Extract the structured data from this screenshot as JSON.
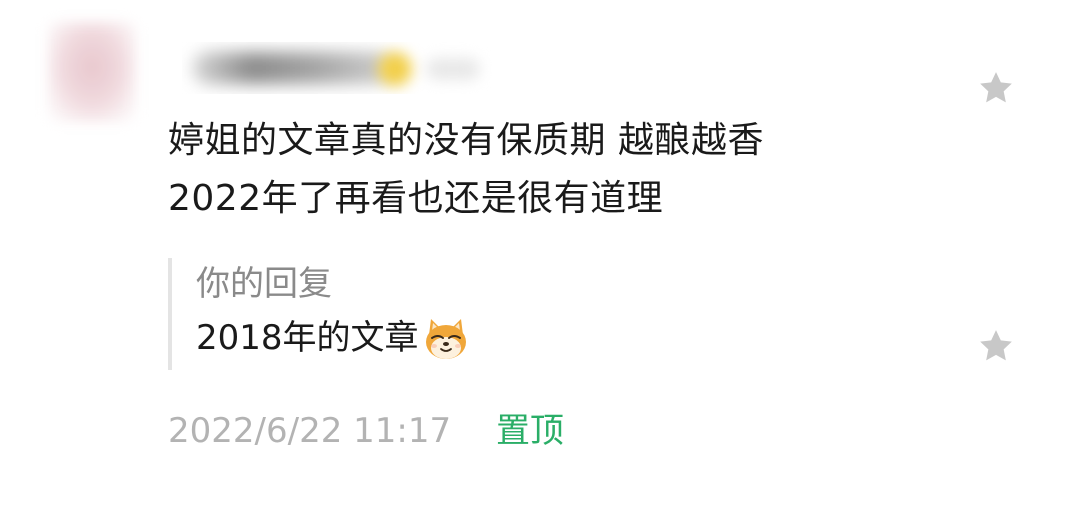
{
  "comment": {
    "line1": "婷姐的文章真的没有保质期 越酿越香",
    "line2": "2022年了再看也还是很有道理"
  },
  "reply": {
    "label": "你的回复",
    "text": "2018年的文章",
    "emoji": "shiba-dog-smirk-emoji"
  },
  "meta": {
    "timestamp": "2022/6/22 11:17",
    "pin_label": "置顶"
  },
  "icons": {
    "favorite": "star-icon"
  },
  "colors": {
    "pin_green": "#2aae67",
    "star_gray": "#c8c8c8",
    "timestamp_gray": "#b3b3b3",
    "reply_label_gray": "#8a8a8a"
  }
}
